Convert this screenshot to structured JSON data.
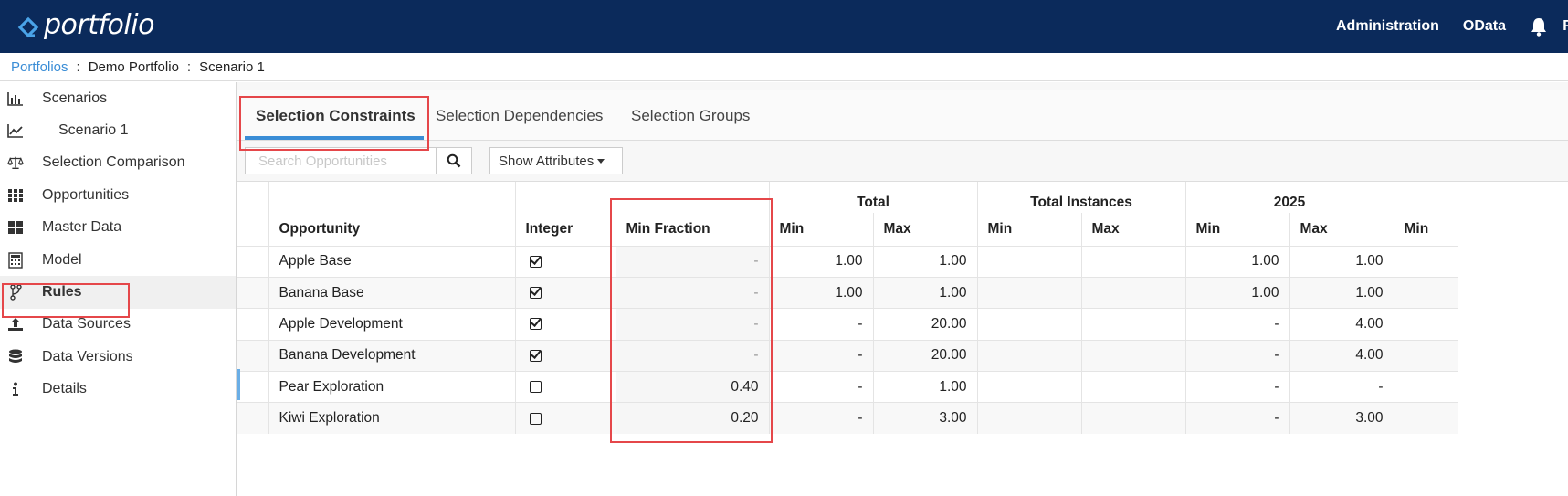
{
  "brand": {
    "name": "portfolio",
    "color": "#0b2a5b"
  },
  "topnav": {
    "items": [
      "Administration",
      "OData"
    ],
    "bell_icon": "bell-icon",
    "cut_text": "F"
  },
  "breadcrumb": {
    "root": "Portfolios",
    "separator": ":",
    "items": [
      "Demo Portfolio",
      "Scenario 1"
    ]
  },
  "sidebar": {
    "items": [
      {
        "label": "Scenarios",
        "icon": "bar-chart-icon"
      },
      {
        "label": "Scenario 1",
        "icon": "line-chart-icon"
      },
      {
        "label": "Selection Comparison",
        "icon": "balance-scale-icon"
      },
      {
        "label": "Opportunities",
        "icon": "grid-icon"
      },
      {
        "label": "Master Data",
        "icon": "tiles-icon"
      },
      {
        "label": "Model",
        "icon": "calculator-icon"
      },
      {
        "label": "Rules",
        "icon": "code-fork-icon"
      },
      {
        "label": "Data Sources",
        "icon": "upload-icon"
      },
      {
        "label": "Data Versions",
        "icon": "database-icon"
      },
      {
        "label": "Details",
        "icon": "info-icon"
      }
    ]
  },
  "tabs": [
    "Selection Constraints",
    "Selection Dependencies",
    "Selection Groups"
  ],
  "toolbar": {
    "search_placeholder": "Search Opportunities",
    "attributes_label": "Show Attributes"
  },
  "table": {
    "groups": [
      "Total",
      "Total Instances",
      "2025"
    ],
    "columns": [
      "Opportunity",
      "Integer",
      "Min Fraction",
      "Min",
      "Max",
      "Min",
      "Max",
      "Min",
      "Max",
      "Min"
    ],
    "rows": [
      {
        "name": "Apple Base",
        "integer": true,
        "min_fraction": "-",
        "total_min": "1.00",
        "total_max": "1.00",
        "inst_min": "",
        "inst_max": "",
        "y_min": "1.00",
        "y_max": "1.00"
      },
      {
        "name": "Banana Base",
        "integer": true,
        "min_fraction": "-",
        "total_min": "1.00",
        "total_max": "1.00",
        "inst_min": "",
        "inst_max": "",
        "y_min": "1.00",
        "y_max": "1.00"
      },
      {
        "name": "Apple Development",
        "integer": true,
        "min_fraction": "-",
        "total_min": "-",
        "total_max": "20.00",
        "inst_min": "",
        "inst_max": "",
        "y_min": "-",
        "y_max": "4.00"
      },
      {
        "name": "Banana Development",
        "integer": true,
        "min_fraction": "-",
        "total_min": "-",
        "total_max": "20.00",
        "inst_min": "",
        "inst_max": "",
        "y_min": "-",
        "y_max": "4.00"
      },
      {
        "name": "Pear Exploration",
        "integer": false,
        "min_fraction": "0.40",
        "total_min": "-",
        "total_max": "1.00",
        "inst_min": "",
        "inst_max": "",
        "y_min": "-",
        "y_max": "-"
      },
      {
        "name": "Kiwi Exploration",
        "integer": false,
        "min_fraction": "0.20",
        "total_min": "-",
        "total_max": "3.00",
        "inst_min": "",
        "inst_max": "",
        "y_min": "-",
        "y_max": "3.00"
      }
    ]
  }
}
